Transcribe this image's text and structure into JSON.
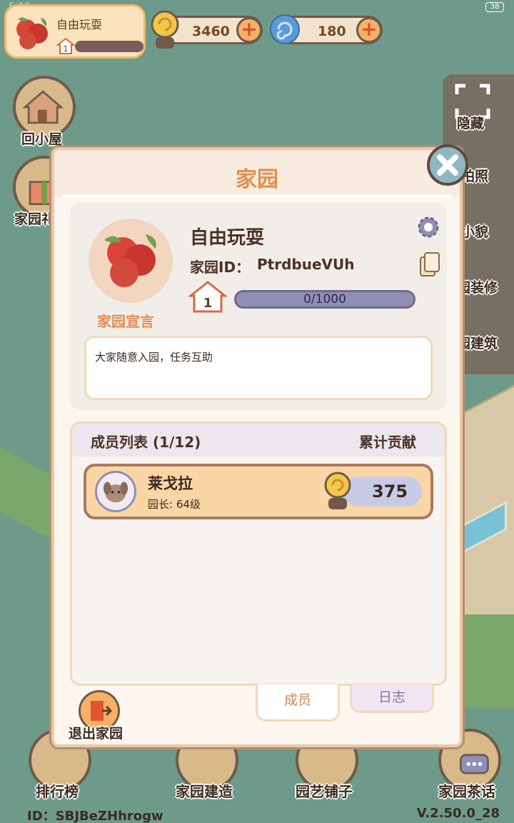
{
  "status_bar": {
    "time": "5:15",
    "battery": "38"
  },
  "profile": {
    "name": "自由玩耍",
    "level": "1"
  },
  "currency": {
    "coins": "3460",
    "gems": "180"
  },
  "left_menu": {
    "home": "回小屋",
    "gift": "家园礼"
  },
  "right_menu": {
    "hide": "隐藏",
    "photo": "拍照",
    "appearance": "小貌",
    "decorate": "园装修",
    "build": "园建筑"
  },
  "bottom_nav": {
    "rank": "排行榜",
    "build": "家园建造",
    "shop": "园艺铺子",
    "chat": "家园茶话"
  },
  "footer": {
    "id": "ID：SBJBeZHhrogw",
    "version": "V.2.50.0_28"
  },
  "modal": {
    "title": "家园",
    "home_name": "自由玩耍",
    "home_id_label": "家园ID：",
    "home_id": "PtrdbueVUh",
    "level": "1",
    "exp": "0/1000",
    "declaration_label": "家园宣言",
    "declaration_text": "大家随意入园，任务互助",
    "members_title": "成员列表 (1/12)",
    "contribution_header": "累计贡献",
    "members": [
      {
        "name": "莱戈拉",
        "role": "园长: 64级",
        "contribution": "375"
      }
    ],
    "tabs": {
      "members": "成员",
      "log": "日志"
    },
    "exit_label": "退出家园"
  },
  "colors": {
    "accent": "#e28f52",
    "modal_border": "#e9c9a6",
    "exp_bar": "#8f8fb6"
  }
}
